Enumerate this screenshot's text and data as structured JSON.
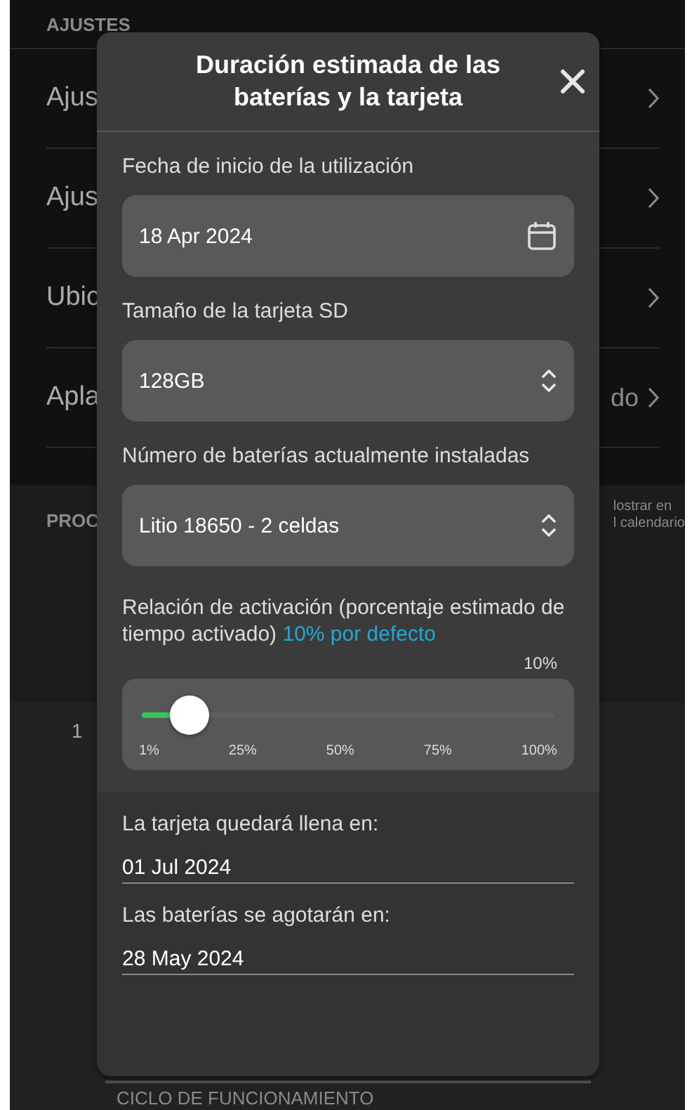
{
  "background": {
    "section_header": "AJUSTES",
    "rows": [
      {
        "label": "Ajus"
      },
      {
        "label": "Ajus"
      },
      {
        "label": "Ubic"
      },
      {
        "label": "Apla",
        "value": "do"
      }
    ],
    "section_2": {
      "header": "PROC",
      "note": [
        "lostrar en",
        "l calendario"
      ]
    },
    "fragment": "1",
    "footer_header": "CICLO DE FUNCIONAMIENTO"
  },
  "dialog": {
    "title": "Duración estimada de las baterías y la tarjeta",
    "fields": [
      {
        "kind": "date",
        "label": "Fecha de inicio de la utilización",
        "value": "18 Apr 2024"
      },
      {
        "kind": "picker",
        "label": "Tamaño de la tarjeta SD",
        "value": "128GB"
      },
      {
        "kind": "picker",
        "label": "Número de baterías actualmente instaladas",
        "value": "Litio 18650 - 2 celdas"
      }
    ],
    "duty": {
      "label": "Relación de activación (porcentaje estimado de tiempo activado)",
      "hint": "10% por defecto",
      "reading": "10%",
      "level": 0.12,
      "ticks": [
        "1%",
        "25%",
        "50%",
        "75%",
        "100%"
      ]
    },
    "results": [
      {
        "label": "La tarjeta quedará llena en:",
        "value": "01 Jul 2024"
      },
      {
        "label": "Las baterías se agotarán en:",
        "value": "28 May 2024"
      }
    ]
  }
}
